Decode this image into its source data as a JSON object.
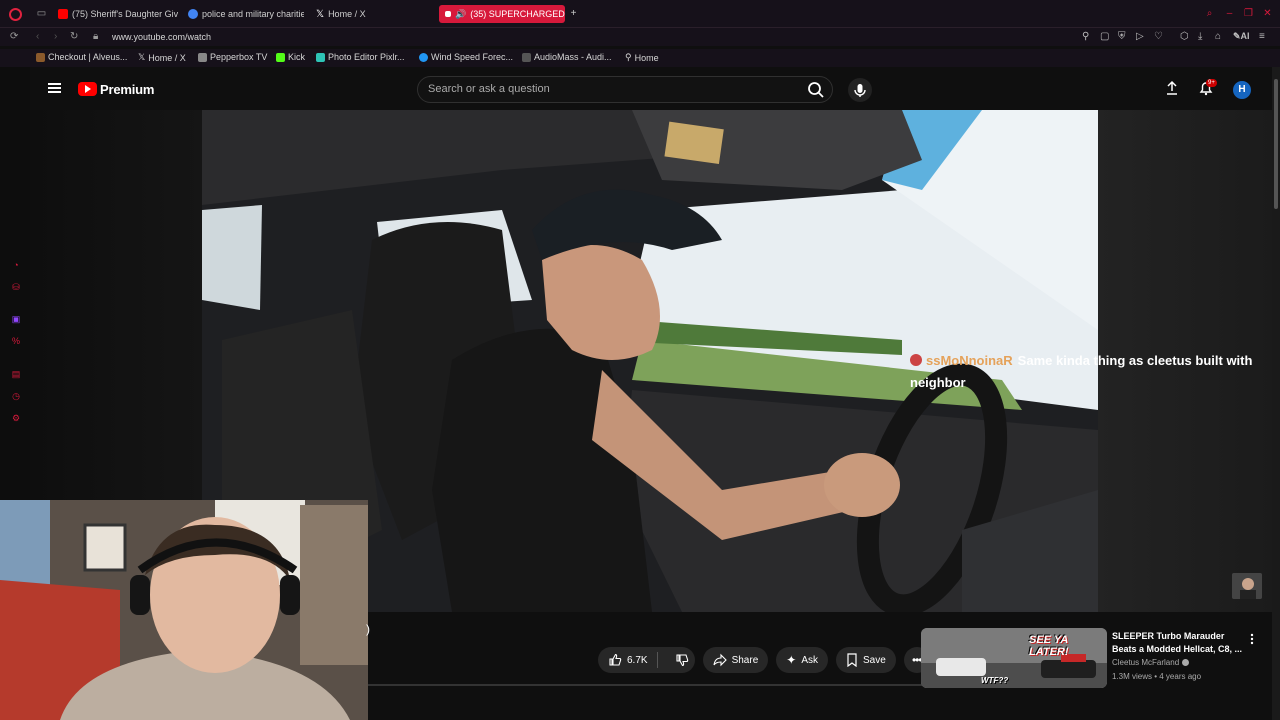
{
  "browser": {
    "tabs": [
      {
        "label": "(75) Sheriff's Daughter Giv",
        "favicon_color": "#ff0000"
      },
      {
        "label": "police and military charitie",
        "favicon_color": "#4285f4"
      },
      {
        "label": "Home / X",
        "favicon_color": "#ffffff"
      },
      {
        "label": "(35) SUPERCHARGED",
        "favicon_color": "#ffffff"
      }
    ],
    "active_tab_index": 3,
    "url": "www.youtube.com/watch",
    "ai_label": "AI",
    "bookmarks": [
      {
        "label": "Checkout | Alveus...",
        "favicon_color": "#8b5a2b"
      },
      {
        "label": "Home / X",
        "favicon_color": "#ffffff"
      },
      {
        "label": "Pepperbox TV",
        "favicon_color": "#888888"
      },
      {
        "label": "Kick",
        "favicon_color": "#53fc18"
      },
      {
        "label": "Photo Editor Pixlr...",
        "favicon_color": "#2ec4b6"
      },
      {
        "label": "Wind Speed Forec...",
        "favicon_color": "#2196f3"
      },
      {
        "label": "AudioMass - Audi...",
        "favicon_color": "#555555"
      },
      {
        "label": "Home",
        "favicon_color": "#ffffff"
      }
    ]
  },
  "youtube": {
    "brand": "Premium",
    "search_placeholder": "Search or ask a question",
    "notification_count": "9+",
    "avatar_initial": "H",
    "accent": "#ff0000"
  },
  "chat_overlay": {
    "username": "ssMoNnoinaR",
    "message": "Same kinda thing as cleetus built with neighbor"
  },
  "video": {
    "title_fragment": ")",
    "like_count": "6.7K",
    "share_label": "Share",
    "ask_label": "Ask",
    "save_label": "Save"
  },
  "recommendation": {
    "title": "SLEEPER Turbo Marauder Beats a Modded Hellcat, C8, ...",
    "channel": "Cleetus McFarland",
    "meta": "1.3M views • 4 years ago",
    "thumb_text_1": "SEE YA LATER!",
    "thumb_text_2": "WTF??"
  }
}
